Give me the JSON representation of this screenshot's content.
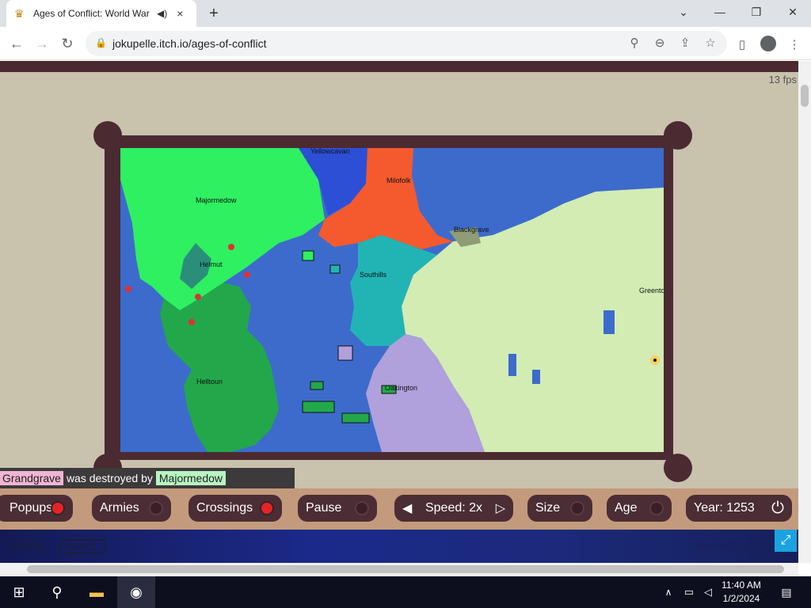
{
  "browser": {
    "tab_title": "Ages of Conflict: World War",
    "url": "jokupelle.itch.io/ages-of-conflict",
    "new_tab": "+",
    "audio_icon": "speaker-icon",
    "close_tab": "×",
    "window_controls": [
      "⌄",
      "—",
      "❐",
      "✕"
    ]
  },
  "game": {
    "fps": "13 fps",
    "notification": {
      "subject": "Grandgrave",
      "text": "was destroyed by",
      "actor": "Majormedow"
    },
    "cities": [
      "Yellowcavan",
      "Milofolk",
      "Majormedow",
      "Blackgrave",
      "Helmut",
      "Southills",
      "Greenton",
      "Helltoun",
      "Oakington"
    ],
    "controls": {
      "popups": "Popups",
      "armies": "Armies",
      "crossings": "Crossings",
      "pause": "Pause",
      "speed": "Speed: 2x",
      "size": "Size",
      "age": "Age",
      "year": "Year: 1253"
    },
    "unity": {
      "logo": "Unity",
      "webgl": "WebGL",
      "title": "Ages of Conflict"
    }
  },
  "taskbar": {
    "time": "11:40 AM",
    "date": "1/2/2024"
  }
}
